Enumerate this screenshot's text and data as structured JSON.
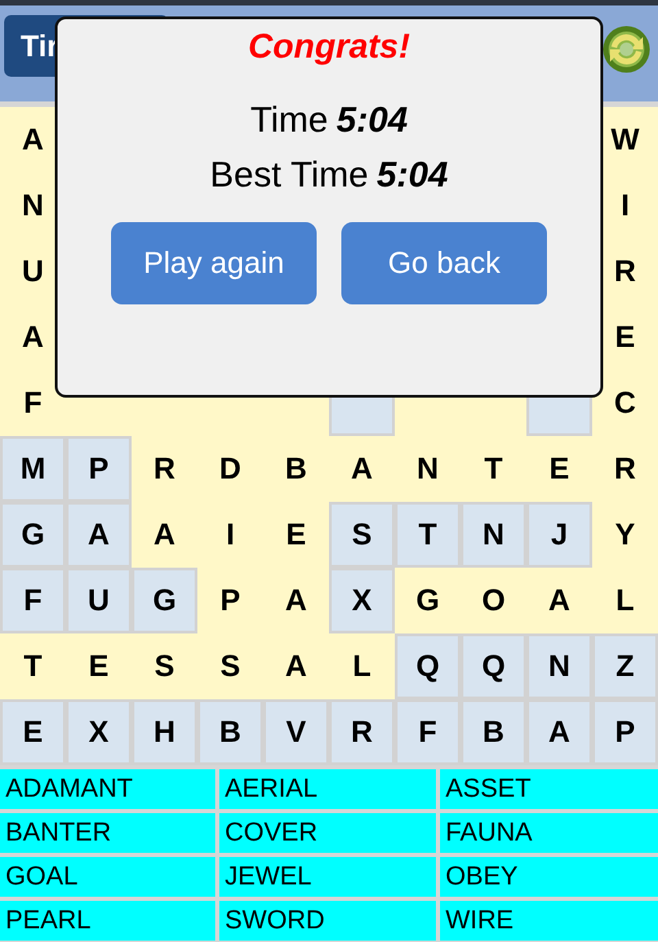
{
  "top_bar": {
    "timer_button": {
      "label": "Tir"
    }
  },
  "grid": {
    "rows": [
      [
        {
          "letter": "A",
          "shaded": false
        },
        null,
        null,
        null,
        null,
        null,
        null,
        null,
        null,
        {
          "letter": "W",
          "shaded": false
        }
      ],
      [
        {
          "letter": "N",
          "shaded": false
        },
        null,
        null,
        null,
        null,
        null,
        null,
        null,
        null,
        {
          "letter": "I",
          "shaded": false
        }
      ],
      [
        {
          "letter": "U",
          "shaded": false
        },
        null,
        null,
        null,
        null,
        null,
        null,
        null,
        null,
        {
          "letter": "R",
          "shaded": false
        }
      ],
      [
        {
          "letter": "A",
          "shaded": false
        },
        null,
        null,
        null,
        null,
        null,
        null,
        null,
        null,
        {
          "letter": "E",
          "shaded": false
        }
      ],
      [
        {
          "letter": "F",
          "shaded": false
        },
        {
          "shaded": false
        },
        {
          "shaded": false
        },
        {
          "shaded": false
        },
        {
          "shaded": false
        },
        {
          "shaded": true
        },
        {
          "shaded": false
        },
        {
          "shaded": false
        },
        {
          "shaded": true
        },
        {
          "letter": "C",
          "shaded": false
        }
      ],
      [
        {
          "letter": "M",
          "shaded": true
        },
        {
          "letter": "P",
          "shaded": true
        },
        {
          "letter": "R",
          "shaded": false
        },
        {
          "letter": "D",
          "shaded": false
        },
        {
          "letter": "B",
          "shaded": false
        },
        {
          "letter": "A",
          "shaded": false
        },
        {
          "letter": "N",
          "shaded": false
        },
        {
          "letter": "T",
          "shaded": false
        },
        {
          "letter": "E",
          "shaded": false
        },
        {
          "letter": "R",
          "shaded": false
        }
      ],
      [
        {
          "letter": "G",
          "shaded": true
        },
        {
          "letter": "A",
          "shaded": true
        },
        {
          "letter": "A",
          "shaded": false
        },
        {
          "letter": "I",
          "shaded": false
        },
        {
          "letter": "E",
          "shaded": false
        },
        {
          "letter": "S",
          "shaded": true
        },
        {
          "letter": "T",
          "shaded": true
        },
        {
          "letter": "N",
          "shaded": true
        },
        {
          "letter": "J",
          "shaded": true
        },
        {
          "letter": "Y",
          "shaded": false
        }
      ],
      [
        {
          "letter": "F",
          "shaded": true
        },
        {
          "letter": "U",
          "shaded": true
        },
        {
          "letter": "G",
          "shaded": true
        },
        {
          "letter": "P",
          "shaded": false
        },
        {
          "letter": "A",
          "shaded": false
        },
        {
          "letter": "X",
          "shaded": true
        },
        {
          "letter": "G",
          "shaded": false
        },
        {
          "letter": "O",
          "shaded": false
        },
        {
          "letter": "A",
          "shaded": false
        },
        {
          "letter": "L",
          "shaded": false
        }
      ],
      [
        {
          "letter": "T",
          "shaded": false
        },
        {
          "letter": "E",
          "shaded": false
        },
        {
          "letter": "S",
          "shaded": false
        },
        {
          "letter": "S",
          "shaded": false
        },
        {
          "letter": "A",
          "shaded": false
        },
        {
          "letter": "L",
          "shaded": false
        },
        {
          "letter": "Q",
          "shaded": true
        },
        {
          "letter": "Q",
          "shaded": true
        },
        {
          "letter": "N",
          "shaded": true
        },
        {
          "letter": "Z",
          "shaded": true
        }
      ],
      [
        {
          "letter": "E",
          "shaded": true
        },
        {
          "letter": "X",
          "shaded": true
        },
        {
          "letter": "H",
          "shaded": true
        },
        {
          "letter": "B",
          "shaded": true
        },
        {
          "letter": "V",
          "shaded": true
        },
        {
          "letter": "R",
          "shaded": true
        },
        {
          "letter": "F",
          "shaded": true
        },
        {
          "letter": "B",
          "shaded": true
        },
        {
          "letter": "A",
          "shaded": true
        },
        {
          "letter": "P",
          "shaded": true
        }
      ]
    ]
  },
  "words": [
    "ADAMANT",
    "AERIAL",
    "ASSET",
    "BANTER",
    "COVER",
    "FAUNA",
    "GOAL",
    "JEWEL",
    "OBEY",
    "PEARL",
    "SWORD",
    "WIRE"
  ],
  "dialog": {
    "title": "Congrats!",
    "lines": [
      {
        "label": "Time",
        "value": "5:04"
      },
      {
        "label": "Best Time",
        "value": "5:04"
      }
    ],
    "buttons": [
      "Play again",
      "Go back"
    ]
  }
}
